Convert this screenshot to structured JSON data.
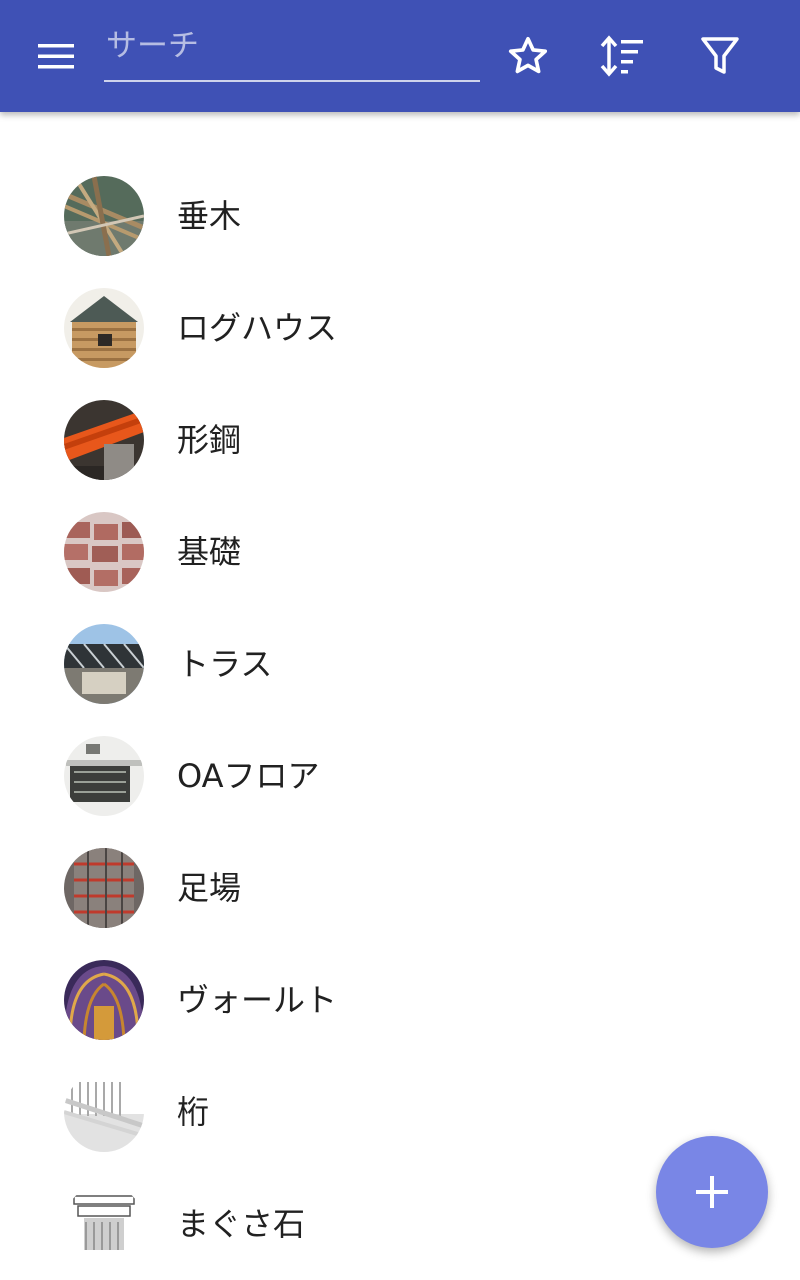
{
  "toolbar": {
    "background": "#3f51b5",
    "menu_icon": "menu-icon",
    "search_placeholder": "サーチ",
    "search_value": "",
    "favorites_icon": "star-outline-icon",
    "sort_icon": "sort-icon",
    "filter_icon": "filter-icon"
  },
  "items": [
    {
      "label": "垂木",
      "thumb": "thumb-rafters"
    },
    {
      "label": "ログハウス",
      "thumb": "thumb-log-house"
    },
    {
      "label": "形鋼",
      "thumb": "thumb-steel-beam"
    },
    {
      "label": "基礎",
      "thumb": "thumb-foundation"
    },
    {
      "label": "トラス",
      "thumb": "thumb-truss"
    },
    {
      "label": "OAフロア",
      "thumb": "thumb-raised-floor"
    },
    {
      "label": "足場",
      "thumb": "thumb-scaffolding"
    },
    {
      "label": "ヴォールト",
      "thumb": "thumb-vault"
    },
    {
      "label": "桁",
      "thumb": "thumb-girder"
    },
    {
      "label": "まぐさ石",
      "thumb": "thumb-lintel"
    }
  ],
  "fab": {
    "icon": "plus-icon",
    "color": "#7986e6"
  }
}
